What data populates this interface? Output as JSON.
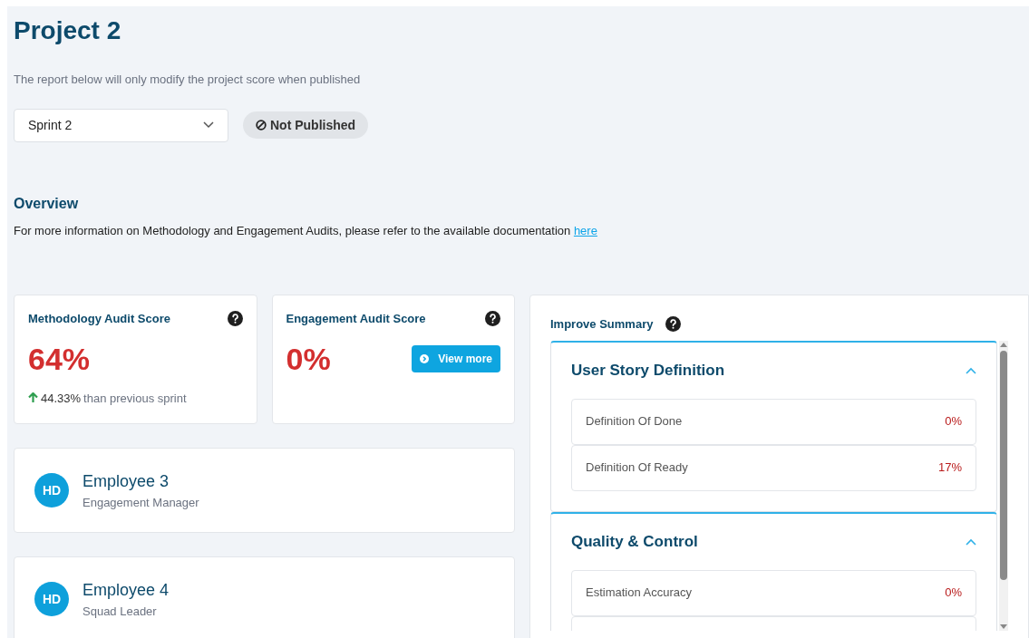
{
  "title": "Project 2",
  "notice": "The report below will only modify the project score when published",
  "sprint_select": {
    "value": "Sprint 2"
  },
  "publish_badge": {
    "label": "Not Published",
    "published": false
  },
  "overview": {
    "heading": "Overview",
    "text": "For more information on Methodology and Engagement Audits, please refer to the available documentation ",
    "link": "here"
  },
  "score_cards": [
    {
      "title": "Methodology Audit Score",
      "score": "64%",
      "change": "44.33%",
      "change_text": "than previous sprint",
      "increased": true
    },
    {
      "title": "Engagement Audit Score",
      "score": "0%",
      "button": "View more"
    }
  ],
  "employees": [
    {
      "initials": "HD",
      "name": "Employee 3",
      "role": "Engagement Manager"
    },
    {
      "initials": "HD",
      "name": "Employee 4",
      "role": "Squad Leader"
    }
  ],
  "improve_summary": {
    "title": "Improve Summary",
    "sections": [
      {
        "title": "User Story Definition",
        "expanded": true,
        "items": [
          {
            "label": "Definition Of Done",
            "value": "0%"
          },
          {
            "label": "Definition Of Ready",
            "value": "17%"
          }
        ]
      },
      {
        "title": "Quality & Control",
        "expanded": true,
        "items": [
          {
            "label": "Estimation Accuracy",
            "value": "0%"
          }
        ]
      }
    ]
  }
}
